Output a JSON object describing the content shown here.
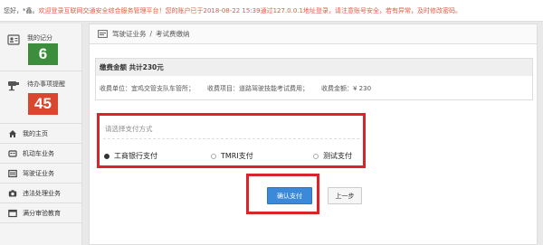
{
  "header": {
    "greeting": "您好，*鑫。",
    "welcome": "欢迎登录互联网交通安全综合服务管理平台！",
    "notice": "您的账户已于2018-08-22 15:39通过127.0.0.1地址登录，请注意账号安全，若有异常，",
    "change_password_link": "及时修改密码。"
  },
  "sidebar": {
    "stats": [
      {
        "label": "我的记分",
        "value": "6",
        "icon": "id-card-icon",
        "color": "#3c8d3c"
      },
      {
        "label": "待办事项提醒",
        "value": "45",
        "icon": "camera-icon",
        "color": "#d9472f"
      }
    ],
    "menu": [
      {
        "label": "我的主页",
        "icon": "home-icon"
      },
      {
        "label": "机动车业务",
        "icon": "car-icon"
      },
      {
        "label": "驾驶证业务",
        "icon": "license-icon"
      },
      {
        "label": "违法处理业务",
        "icon": "camera-icon"
      },
      {
        "label": "满分审验教育",
        "icon": "book-icon"
      }
    ]
  },
  "breadcrumb": {
    "parent": "驾驶证业务",
    "separator": "/",
    "current": "考试费缴纳"
  },
  "payment": {
    "title": "缴费金额  共计230元",
    "unit": "收费单位：宜鸡交管支队车管所；",
    "item": "收费项目：道路驾驶技能考试费用；",
    "amount": "收费金额：¥ 230"
  },
  "method": {
    "title": "请选择支付方式",
    "options": [
      "工商银行支付",
      "TMRI支付",
      "测试支付"
    ],
    "selected_index": 0
  },
  "buttons": {
    "confirm": "确认支付",
    "back": "上一步"
  },
  "colors": {
    "highlight_red": "#d8242a",
    "primary_blue": "#3b8ad9",
    "score_green": "#3c8d3c",
    "alert_red": "#d9472f"
  }
}
